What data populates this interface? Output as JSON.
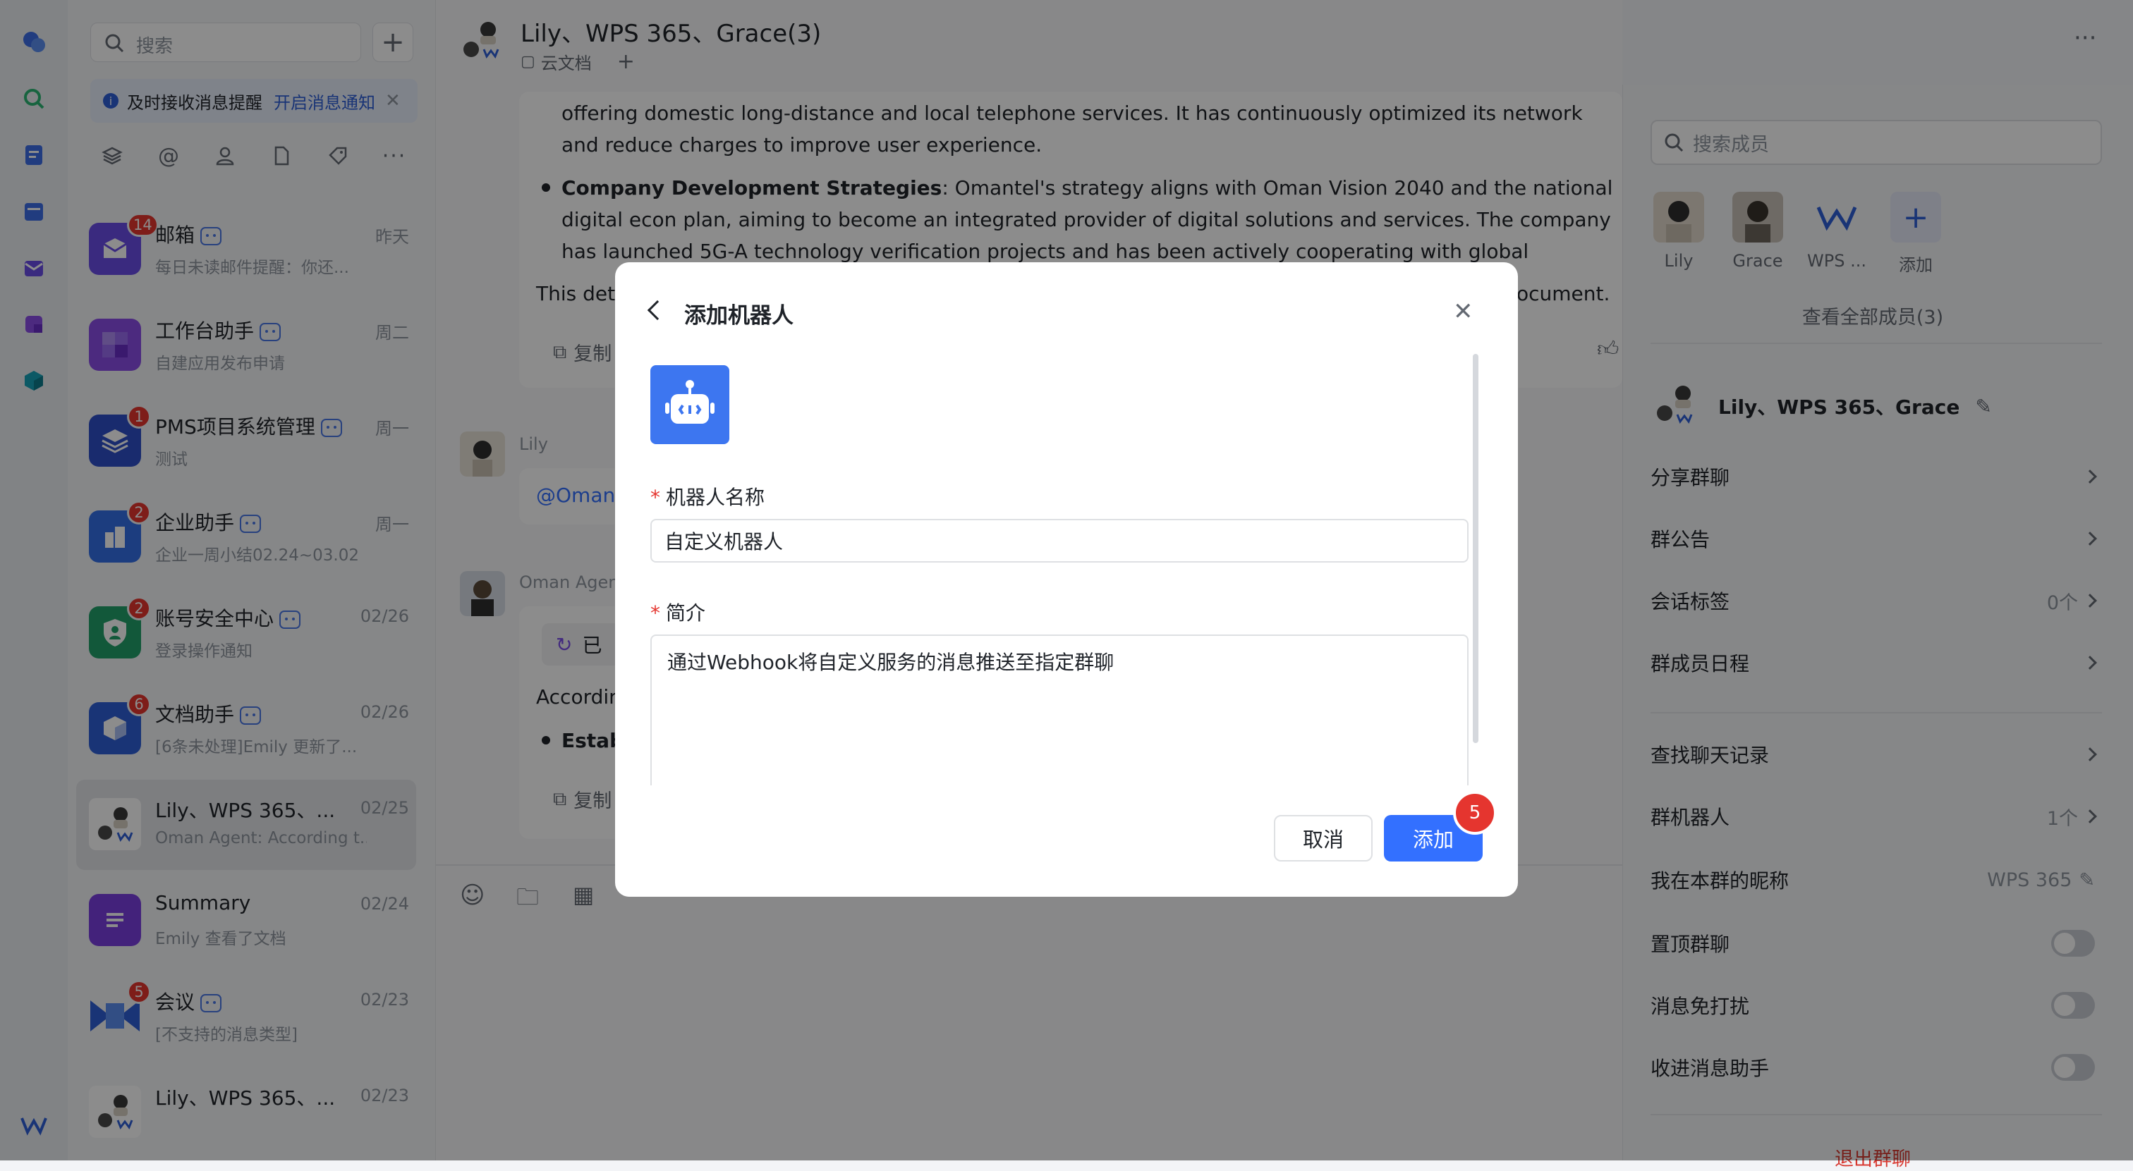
{
  "sidebar_search": {
    "placeholder": "搜索"
  },
  "notice": {
    "text": "及时接收消息提醒",
    "action": "开启消息通知"
  },
  "conversations": [
    {
      "name": "邮箱",
      "time": "昨天",
      "preview": "每日未读邮件提醒：你还...",
      "badge": "14"
    },
    {
      "name": "工作台助手",
      "time": "周二",
      "preview": "自建应用发布申请",
      "badge": ""
    },
    {
      "name": "PMS项目系统管理",
      "time": "周一",
      "preview": "测试",
      "badge": "1"
    },
    {
      "name": "企业助手",
      "time": "周一",
      "preview": "企业一周小结02.24~03.02",
      "badge": "2"
    },
    {
      "name": "账号安全中心",
      "time": "02/26",
      "preview": "登录操作通知",
      "badge": "2"
    },
    {
      "name": "文档助手",
      "time": "02/26",
      "preview": "[6条未处理]Emily 更新了...",
      "badge": "6"
    },
    {
      "name": "Lily、WPS 365、...",
      "time": "02/25",
      "preview": "Oman Agent: According t...",
      "badge": ""
    },
    {
      "name": "Summary",
      "time": "02/24",
      "preview": "Emily 查看了文档",
      "badge": ""
    },
    {
      "name": "会议",
      "time": "02/23",
      "preview": "[不支持的消息类型]",
      "badge": "5"
    },
    {
      "name": "Lily、WPS 365、...",
      "time": "02/23",
      "preview": "",
      "badge": ""
    }
  ],
  "chat": {
    "title": "Lily、WPS 365、Grace(3)",
    "tab": "云文档",
    "para1": "offering domestic long-distance and local telephone services. It has continuously optimized its network and reduce charges to improve user experience.",
    "bullet_title": "Company Development Strategies",
    "bullet_text": ": Omantel's strategy aligns with Oman Vision 2040 and the national digital econ plan, aiming to become an integrated provider of digital solutions and services. The company has launched 5G-A technology verification projects and has been actively cooperating with global technology companies.",
    "summary_start": "This deta",
    "summary_end": "ocument.",
    "copy_label": "复制",
    "sender_lily": "Lily",
    "mention": "@Oman",
    "sender_agent": "Oman Agent",
    "agent_status": "已",
    "according": "Accordin",
    "estab": "Estab"
  },
  "right_panel": {
    "search_placeholder": "搜索成员",
    "members": [
      "Lily",
      "Grace",
      "WPS ...",
      "添加"
    ],
    "view_all": "查看全部成员(3)",
    "group_name": "Lily、WPS 365、Grace",
    "rows": [
      {
        "label": "分享群聊",
        "value": ""
      },
      {
        "label": "群公告",
        "value": ""
      },
      {
        "label": "会话标签",
        "value": "0个"
      },
      {
        "label": "群成员日程",
        "value": ""
      },
      {
        "label": "查找聊天记录",
        "value": ""
      },
      {
        "label": "群机器人",
        "value": "1个"
      },
      {
        "label": "我在本群的昵称",
        "value": "WPS 365"
      }
    ],
    "toggles": [
      "置顶群聊",
      "消息免打扰",
      "收进消息助手"
    ],
    "exit": "退出群聊"
  },
  "modal": {
    "title": "添加机器人",
    "name_label": "机器人名称",
    "name_value": "自定义机器人",
    "intro_label": "简介",
    "intro_value": "通过Webhook将自定义服务的消息推送至指定群聊",
    "cancel": "取消",
    "add": "添加",
    "step_badge": "5"
  },
  "colors": {
    "accent": "#3370ff",
    "badge_red": "#e5352f",
    "brand_blue": "#3d6ee8"
  }
}
